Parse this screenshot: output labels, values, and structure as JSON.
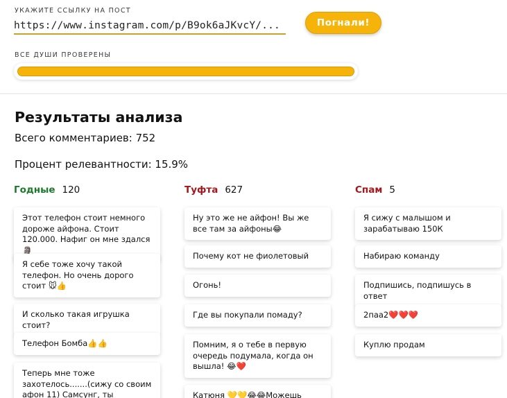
{
  "post_link": {
    "label": "УКАЖИТЕ ССЫЛКУ НА ПОСТ",
    "value": "https://www.instagram.com/p/B9ok6aJKvcY/...",
    "button": "Погнали!"
  },
  "progress": {
    "label": "ВСЕ ДУШИ ПРОВЕРЕНЫ",
    "fraction": 1.0
  },
  "results": {
    "title": "Результаты анализа",
    "total_comments": "Всего комментариев: 752",
    "relevance": "Процент релевантности: 15.9%"
  },
  "columns": [
    {
      "name": "Годные",
      "count": "120",
      "cards": [
        "Этот телефон стоит немного дороже айфона. Стоит 120.000. Нафиг он мне здался🗿",
        "Я себе тоже хочу такой телефон. Но очень дорого стоит 🐭👍",
        "И сколько такая игрушка стоит?",
        "Телефон Бомба👍👍",
        "Теперь мне тоже захотелось.......(сижу со своим афон 11) Самсунг, ты доведёшь"
      ]
    },
    {
      "name": "Туфта",
      "count": "627",
      "cards": [
        "Ну это же не айфон! Вы же все там за айфоны😂",
        "Почему кот не фиолетовый",
        "Огонь!",
        "Где вы покупали помаду?",
        "Помним, я о тебе в первую очередь подумала, когда он вышла! 😂❤️",
        "Катюня 💛💛😂😂Можешь делать"
      ]
    },
    {
      "name": "Спам",
      "count": "5",
      "cards": [
        "Я сижу с малышом и зарабатываю 150К",
        "Набираю команду",
        "Подпишись, подпишусь в ответ",
        "2паа2❤️❤️❤️",
        "Куплю продам"
      ]
    }
  ],
  "colors": {
    "accent": "#f6b40a",
    "good": "#1b7a2a",
    "bad": "#a4161a"
  }
}
